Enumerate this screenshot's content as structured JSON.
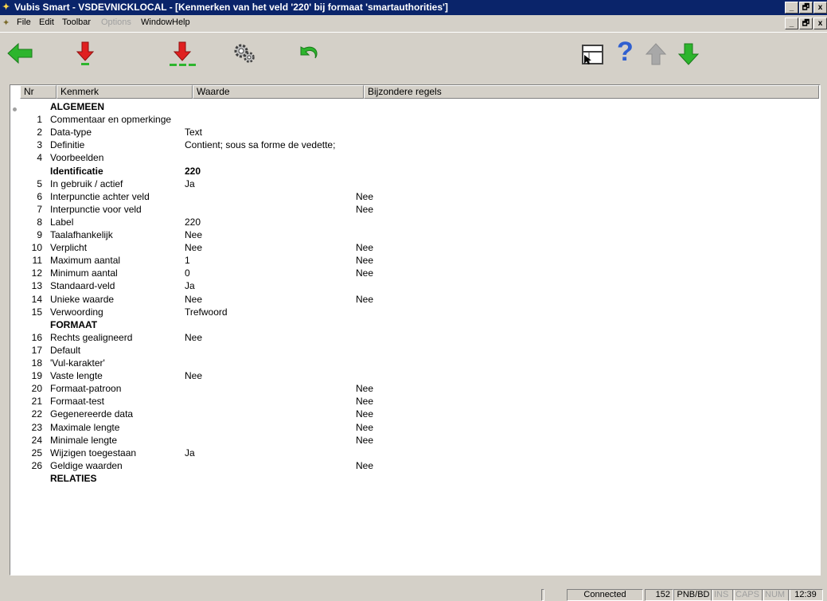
{
  "window": {
    "title": "Vubis Smart - VSDEVNICKLOCAL - [Kenmerken van het veld '220' bij formaat 'smartauthorities']",
    "minimize": "_",
    "restore": "🗗",
    "close": "x"
  },
  "menu": {
    "items": [
      "File",
      "Edit",
      "Toolbar",
      "Options",
      "Window",
      "Help"
    ]
  },
  "toolbar": {
    "icons": [
      "back-arrow-icon",
      "download-arrow-icon",
      "download-multiple-icon",
      "settings-gears-icon",
      "undo-icon",
      "window-select-icon",
      "help-icon",
      "up-arrow-icon",
      "down-arrow-icon"
    ],
    "help_glyph": "?"
  },
  "table": {
    "columns": [
      "Nr",
      "Kenmerk",
      "Waarde",
      "Bijzondere regels"
    ],
    "rows": [
      {
        "nr": "",
        "kenmerk": "ALGEMEEN",
        "waarde": "",
        "regels": "",
        "bold": true
      },
      {
        "nr": "1",
        "kenmerk": "Commentaar en opmerkinge",
        "waarde": "",
        "regels": ""
      },
      {
        "nr": "2",
        "kenmerk": "Data-type",
        "waarde": "Text",
        "regels": ""
      },
      {
        "nr": "3",
        "kenmerk": "Definitie",
        "waarde": "Contient; sous sa forme de vedette;",
        "regels": ""
      },
      {
        "nr": "4",
        "kenmerk": "Voorbeelden",
        "waarde": "",
        "regels": ""
      },
      {
        "nr": "",
        "kenmerk": "Identificatie",
        "waarde": "220",
        "regels": "",
        "bold": true
      },
      {
        "nr": "5",
        "kenmerk": "In gebruik / actief",
        "waarde": "Ja",
        "regels": ""
      },
      {
        "nr": "6",
        "kenmerk": "Interpunctie achter veld",
        "waarde": "",
        "regels": "Nee"
      },
      {
        "nr": "7",
        "kenmerk": "Interpunctie voor veld",
        "waarde": "",
        "regels": "Nee"
      },
      {
        "nr": "8",
        "kenmerk": "Label",
        "waarde": "220",
        "regels": ""
      },
      {
        "nr": "9",
        "kenmerk": "Taalafhankelijk",
        "waarde": "Nee",
        "regels": ""
      },
      {
        "nr": "10",
        "kenmerk": "Verplicht",
        "waarde": "Nee",
        "regels": "Nee"
      },
      {
        "nr": "11",
        "kenmerk": "Maximum aantal",
        "waarde": "1",
        "regels": "Nee"
      },
      {
        "nr": "12",
        "kenmerk": "Minimum aantal",
        "waarde": "0",
        "regels": "Nee"
      },
      {
        "nr": "13",
        "kenmerk": "Standaard-veld",
        "waarde": "Ja",
        "regels": ""
      },
      {
        "nr": "14",
        "kenmerk": "Unieke waarde",
        "waarde": "Nee",
        "regels": "Nee"
      },
      {
        "nr": "15",
        "kenmerk": "Verwoording",
        "waarde": "Trefwoord",
        "regels": ""
      },
      {
        "nr": "",
        "kenmerk": "FORMAAT",
        "waarde": "",
        "regels": "",
        "bold": true
      },
      {
        "nr": "16",
        "kenmerk": "Rechts gealigneerd",
        "waarde": "Nee",
        "regels": ""
      },
      {
        "nr": "17",
        "kenmerk": "Default",
        "waarde": "",
        "regels": ""
      },
      {
        "nr": "18",
        "kenmerk": "'Vul-karakter'",
        "waarde": "",
        "regels": ""
      },
      {
        "nr": "19",
        "kenmerk": "Vaste lengte",
        "waarde": "Nee",
        "regels": ""
      },
      {
        "nr": "20",
        "kenmerk": "Formaat-patroon",
        "waarde": "",
        "regels": "Nee"
      },
      {
        "nr": "21",
        "kenmerk": "Formaat-test",
        "waarde": "",
        "regels": "Nee"
      },
      {
        "nr": "22",
        "kenmerk": "Gegenereerde data",
        "waarde": "",
        "regels": "Nee"
      },
      {
        "nr": "23",
        "kenmerk": "Maximale lengte",
        "waarde": "",
        "regels": "Nee"
      },
      {
        "nr": "24",
        "kenmerk": "Minimale lengte",
        "waarde": "",
        "regels": "Nee"
      },
      {
        "nr": "25",
        "kenmerk": "Wijzigen toegestaan",
        "waarde": "Ja",
        "regels": ""
      },
      {
        "nr": "26",
        "kenmerk": "Geldige waarden",
        "waarde": "",
        "regels": "Nee"
      },
      {
        "nr": "",
        "kenmerk": "RELATIES",
        "waarde": "",
        "regels": "",
        "bold": true
      }
    ]
  },
  "status": {
    "connection": "Connected",
    "count": "152",
    "db": "PNB/BD",
    "ins": "INS",
    "caps": "CAPS",
    "num": "NUM",
    "time": "12:39"
  },
  "colors": {
    "titlebar": "#0a246a",
    "green_arrow": "#2db52d",
    "red_arrow": "#e02020",
    "grey_arrow": "#a8a8a8",
    "help_blue": "#2f5fd0"
  }
}
